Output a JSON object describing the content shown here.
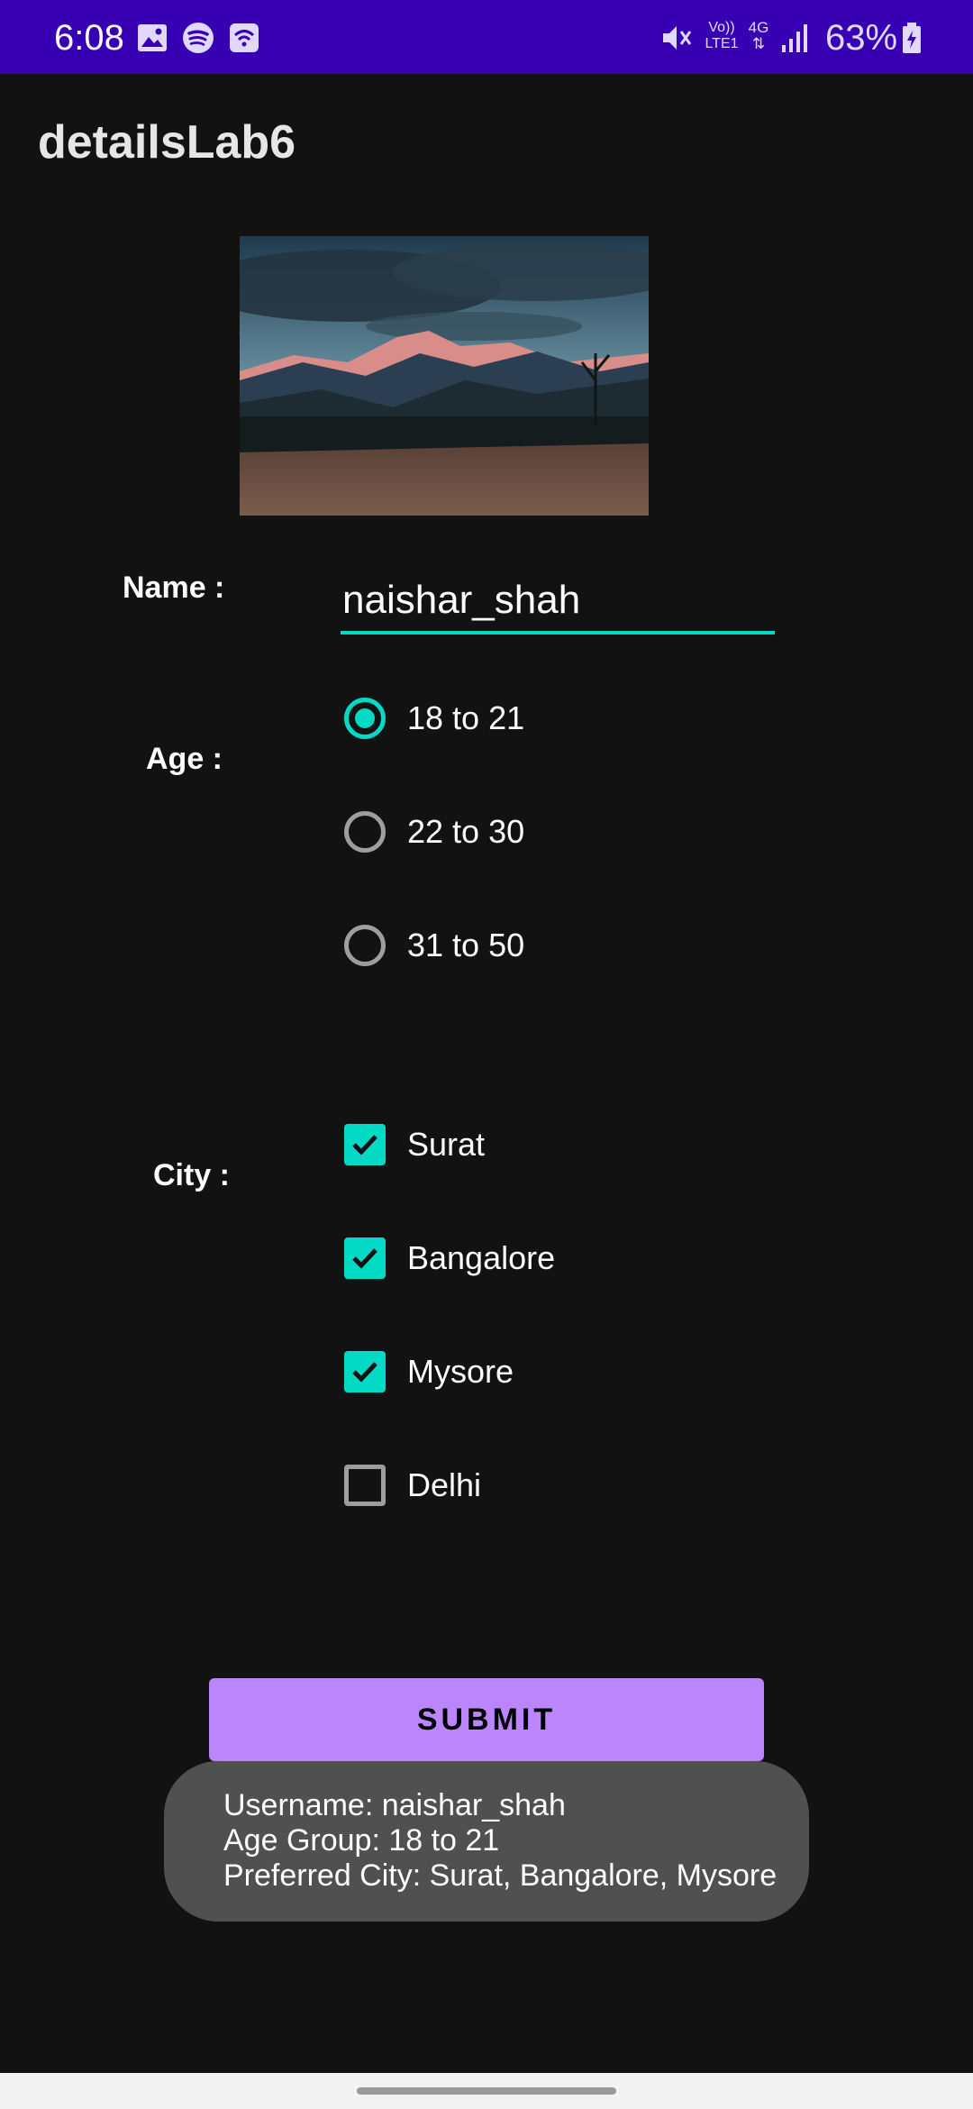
{
  "status_bar": {
    "time": "6:08",
    "battery_percent": "63%",
    "network_label_top": "Vo))",
    "network_label_bottom": "LTE1",
    "data_label": "4G",
    "icons": [
      "gallery-icon",
      "spotify-icon",
      "wifi-calling-icon",
      "mute-icon",
      "volte-icon",
      "data-4g-icon",
      "signal-icon",
      "battery-charging-icon"
    ]
  },
  "app_bar": {
    "title": "detailsLab6"
  },
  "form": {
    "name_label": "Name :",
    "name_value": "naishar_shah",
    "age_label": "Age :",
    "age_options": [
      {
        "label": "18 to 21",
        "selected": true
      },
      {
        "label": "22 to 30",
        "selected": false
      },
      {
        "label": "31 to 50",
        "selected": false
      }
    ],
    "city_label": "City :",
    "city_options": [
      {
        "label": "Surat",
        "checked": true
      },
      {
        "label": "Bangalore",
        "checked": true
      },
      {
        "label": "Mysore",
        "checked": true
      },
      {
        "label": "Delhi",
        "checked": false
      }
    ],
    "submit_label": "SUBMIT"
  },
  "toast": {
    "line1": "Username: naishar_shah",
    "line2": "Age Group: 18 to 21",
    "line3": "Preferred City: Surat, Bangalore, Mysore"
  },
  "colors": {
    "status_bar": "#3700b3",
    "background": "#121212",
    "accent": "#03dac5",
    "button": "#bb86fc",
    "toast": "#505050"
  }
}
